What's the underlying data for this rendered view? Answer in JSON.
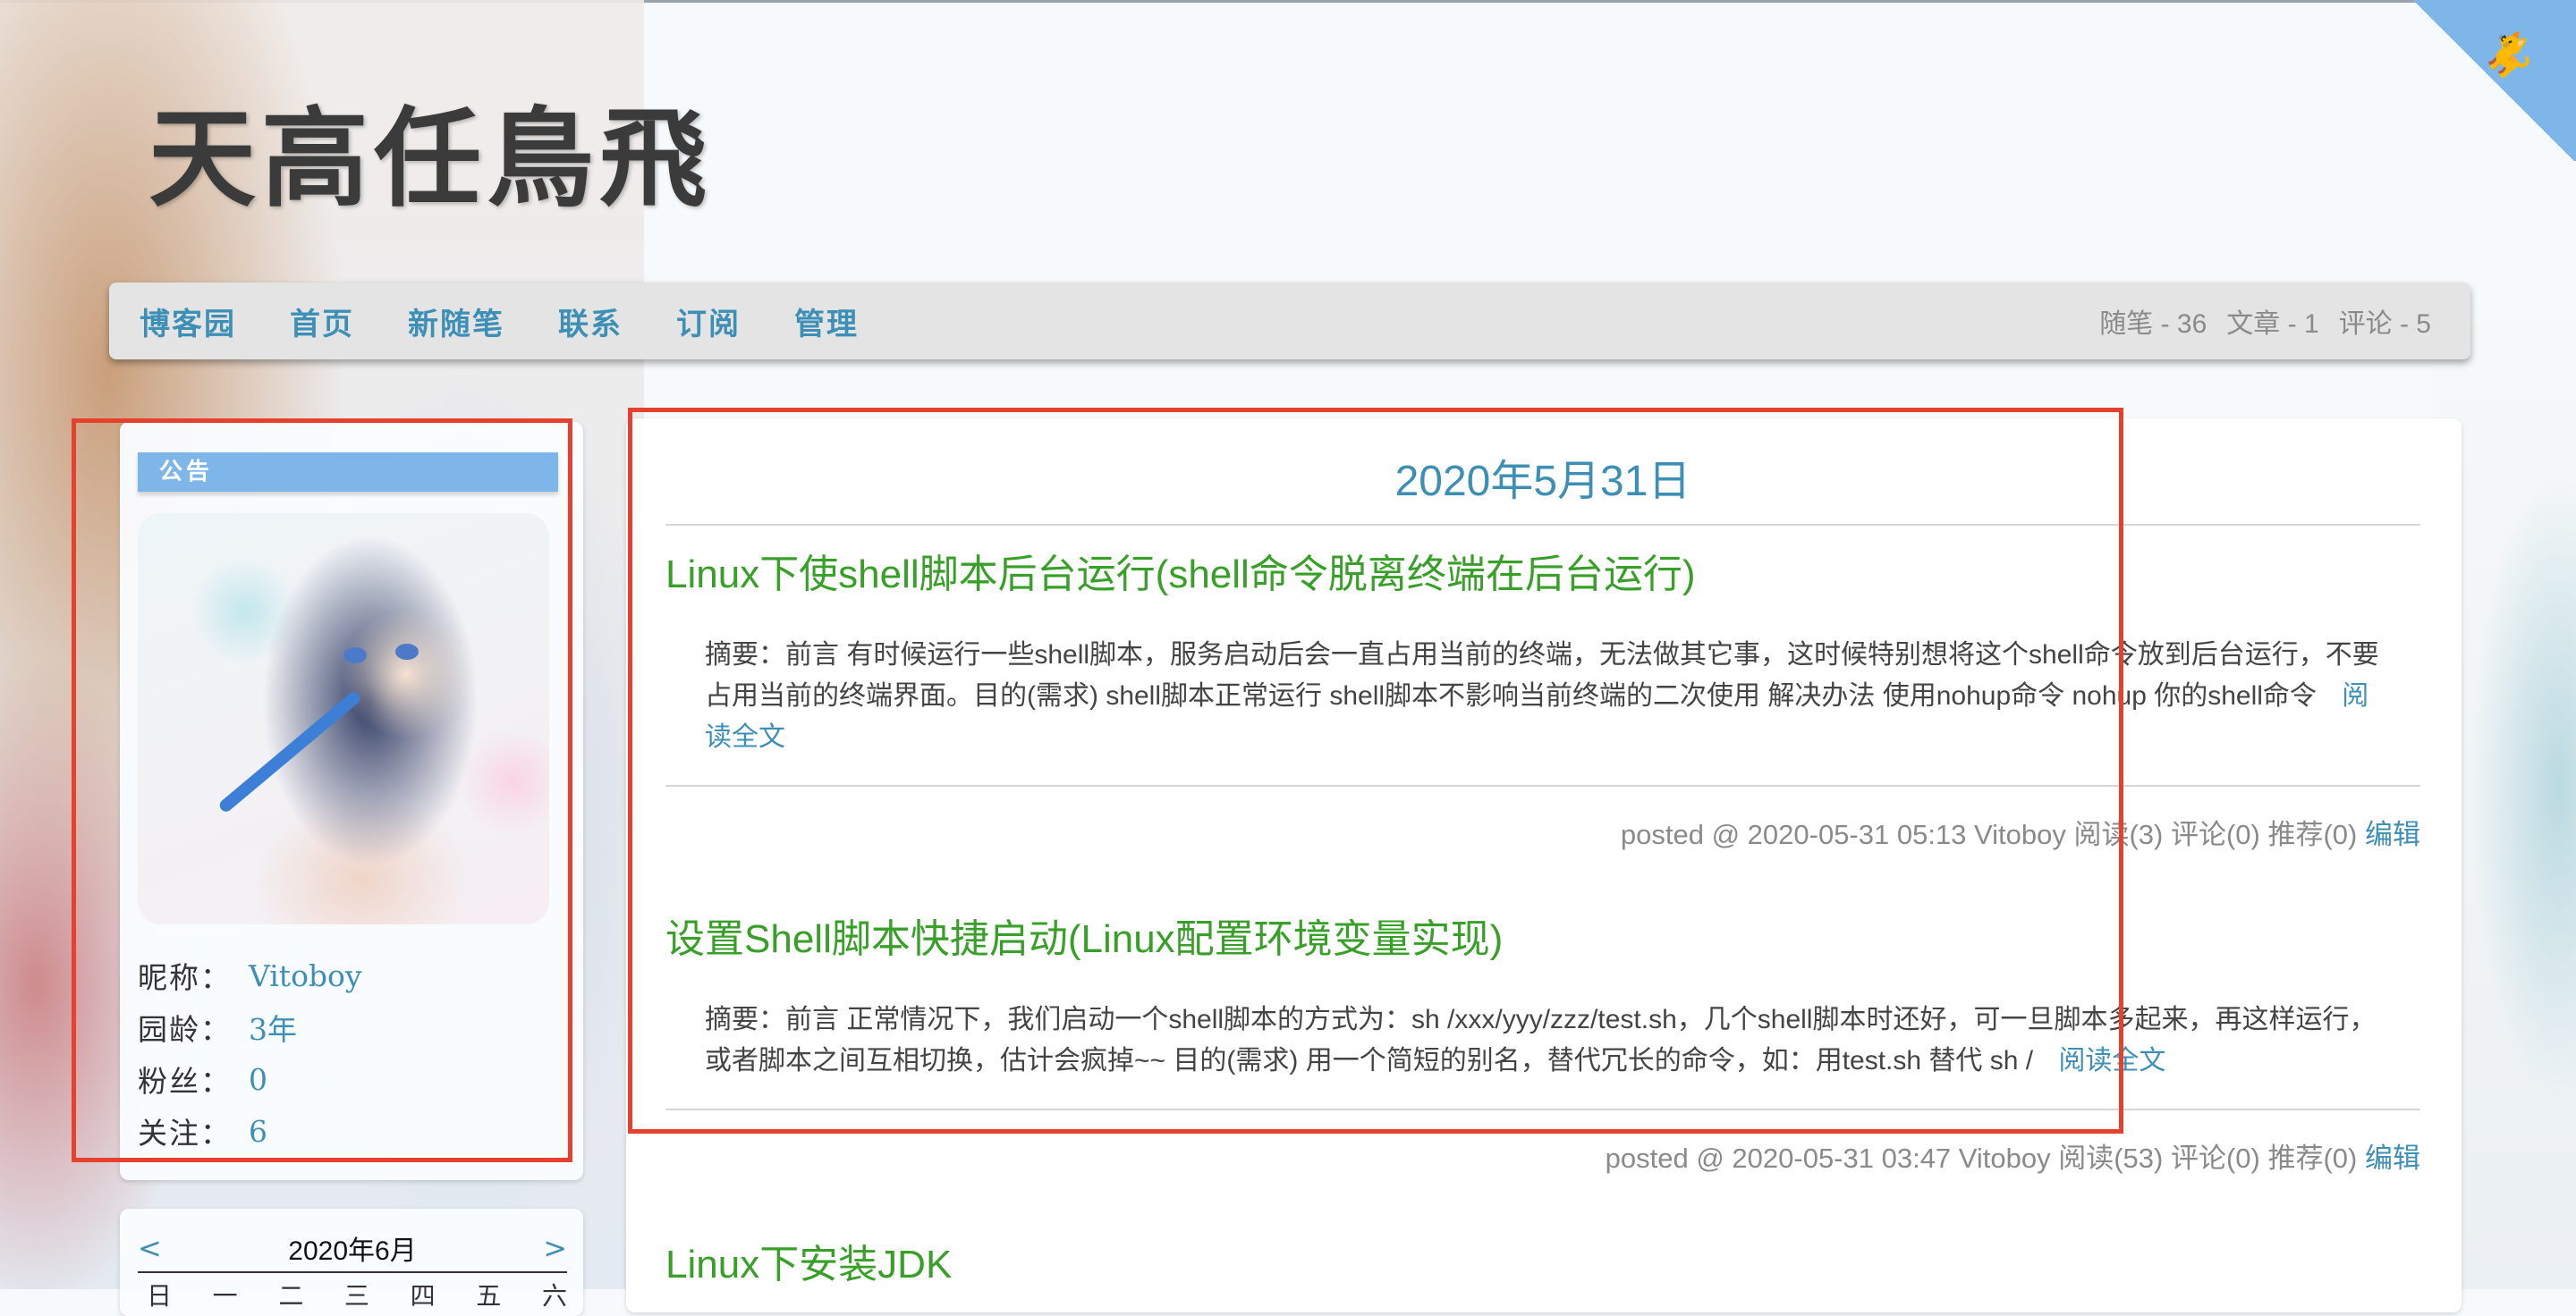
{
  "site": {
    "title": "天高任鳥飛"
  },
  "nav": {
    "links": [
      "博客园",
      "首页",
      "新随笔",
      "联系",
      "订阅",
      "管理"
    ],
    "stats": [
      "随笔 - 36",
      "文章 - 1",
      "评论 - 5"
    ]
  },
  "sidebar": {
    "notice_title": "公告",
    "profile": [
      {
        "label": "昵称：",
        "value": "Vitoboy"
      },
      {
        "label": "园龄：",
        "value": "3年"
      },
      {
        "label": "粉丝：",
        "value": "0"
      },
      {
        "label": "关注：",
        "value": "6"
      }
    ],
    "calendar": {
      "prev": "<",
      "month": "2020年6月",
      "next": ">",
      "weekdays": [
        "日",
        "一",
        "二",
        "三",
        "四",
        "五",
        "六"
      ]
    }
  },
  "main": {
    "day_title": "2020年5月31日",
    "posts": [
      {
        "title": "Linux下使shell脚本后台运行(shell命令脱离终端在后台运行)",
        "summary": "摘要：前言 有时候运行一些shell脚本，服务启动后会一直占用当前的终端，无法做其它事，这时候特别想将这个shell命令放到后台运行，不要占用当前的终端界面。目的(需求) shell脚本正常运行 shell脚本不影响当前终端的二次使用 解决办法 使用nohup命令 nohup 你的shell命令",
        "read_more": "阅读全文",
        "meta": "posted @ 2020-05-31 05:13 Vitoboy 阅读(3) 评论(0) 推荐(0)",
        "edit": "编辑"
      },
      {
        "title": "设置Shell脚本快捷启动(Linux配置环境变量实现)",
        "summary": "摘要：前言 正常情况下，我们启动一个shell脚本的方式为：sh /xxx/yyy/zzz/test.sh，几个shell脚本时还好，可一旦脚本多起来，再这样运行，或者脚本之间互相切换，估计会疯掉~~ 目的(需求) 用一个简短的别名，替代冗长的命令，如：用test.sh 替代 sh /",
        "read_more": "阅读全文",
        "meta": "posted @ 2020-05-31 03:47 Vitoboy 阅读(53) 评论(0) 推荐(0)",
        "edit": "编辑"
      },
      {
        "title": "Linux下安装JDK"
      }
    ]
  },
  "colors": {
    "accent": "#3d8fb6",
    "post_title": "#38a028",
    "notice_bar": "#7fb6ea",
    "annotation": "#e5412e"
  },
  "icons": {
    "corner": "github-cat-icon"
  }
}
